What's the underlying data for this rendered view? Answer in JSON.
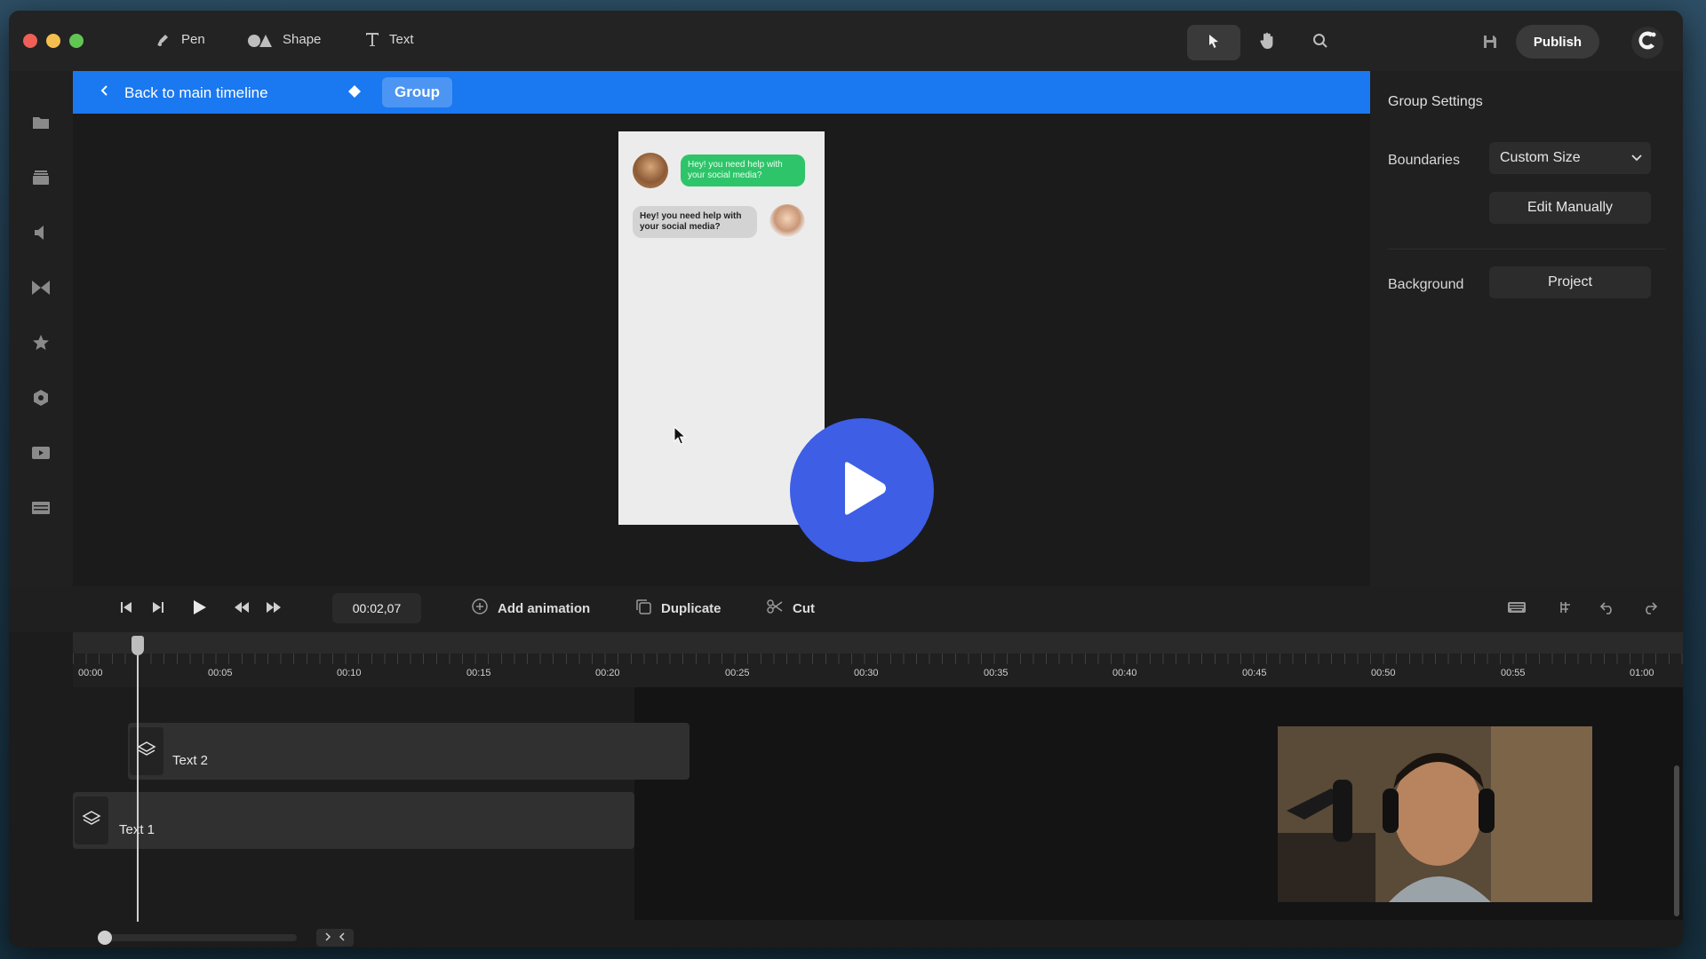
{
  "toolbar": {
    "pen_label": "Pen",
    "shape_label": "Shape",
    "text_label": "Text",
    "publish_label": "Publish"
  },
  "group_bar": {
    "back_label": "Back to main timeline",
    "group_label": "Group"
  },
  "chat": {
    "message_1": "Hey!  you need help with your social media?",
    "message_2": "Hey!  you need help with your social media?"
  },
  "settings": {
    "title": "Group Settings",
    "boundaries_label": "Boundaries",
    "boundaries_value": "Custom Size",
    "edit_manually_label": "Edit Manually",
    "background_label": "Background",
    "background_value": "Project"
  },
  "transport": {
    "timecode": "00:02,07",
    "add_animation_label": "Add animation",
    "duplicate_label": "Duplicate",
    "cut_label": "Cut"
  },
  "ruler": {
    "ticks": [
      "00:00",
      "00:05",
      "00:10",
      "00:15",
      "00:20",
      "00:25",
      "00:30",
      "00:35",
      "00:40",
      "00:45",
      "00:50",
      "00:55",
      "01:00"
    ]
  },
  "tracks": {
    "track_1_label": "Text 2",
    "track_2_label": "Text 1"
  },
  "colors": {
    "accent_blue": "#1a78f0",
    "play_button": "#3e5ee6",
    "chat_green": "#2ec46a"
  }
}
